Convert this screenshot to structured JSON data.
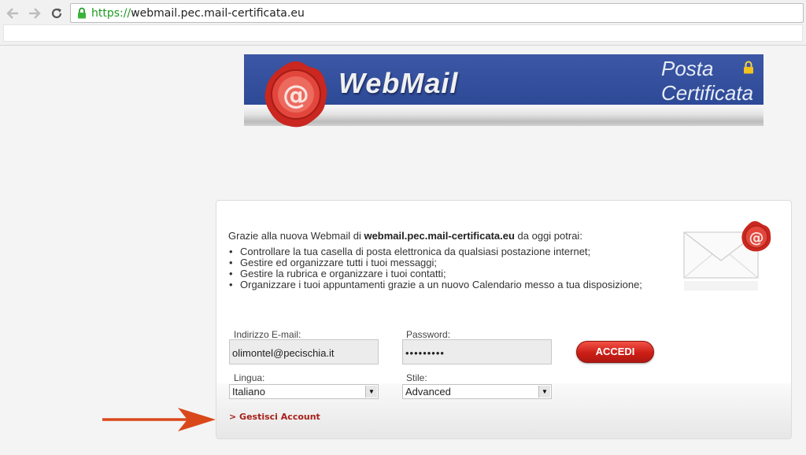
{
  "browser": {
    "url_scheme": "https://",
    "url_host": "webmail.pec.mail-certificata.eu",
    "back_icon": "back-arrow-icon",
    "forward_icon": "forward-arrow-icon",
    "reload_icon": "reload-icon",
    "lock_icon": "padlock-icon"
  },
  "banner": {
    "title": "WebMail",
    "subtitle_line1": "Posta",
    "subtitle_line2": "Certificata",
    "colors": {
      "blue": "#34509f",
      "seal": "#d0302a"
    }
  },
  "intro": {
    "prefix": "Grazie alla nuova Webmail di ",
    "domain": "webmail.pec.mail-certificata.eu",
    "suffix": " da oggi potrai:",
    "bullets": [
      "Controllare la tua casella di posta elettronica da qualsiasi postazione internet;",
      "Gestire ed organizzare tutti i tuoi messaggi;",
      "Gestire la rubrica e organizzare i tuoi contatti;",
      "Organizzare i tuoi appuntamenti grazie a un nuovo Calendario messo a tua disposizione;"
    ]
  },
  "form": {
    "email_label": "Indirizzo E-mail:",
    "email_value": "olimontel@pecischia.it",
    "password_label": "Password:",
    "password_value": "•••••••••",
    "login_button": "ACCEDI",
    "language_label": "Lingua:",
    "language_value": "Italiano",
    "style_label": "Stile:",
    "style_value": "Advanced",
    "manage_link": "> Gestisci Account"
  },
  "accent_colors": {
    "button_red": "#d4231b",
    "link_red": "#a8201a",
    "annotation_arrow": "#d9481a"
  }
}
